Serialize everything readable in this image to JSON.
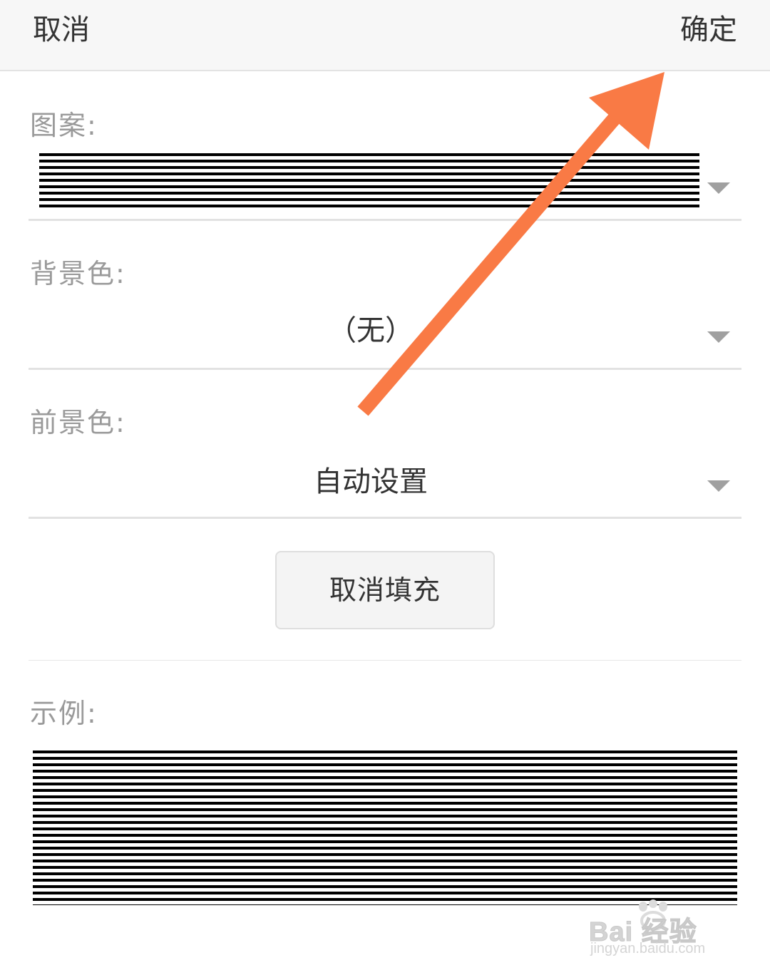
{
  "header": {
    "cancel_label": "取消",
    "confirm_label": "确定"
  },
  "pattern": {
    "label": "图案:"
  },
  "background_color": {
    "label": "背景色:",
    "value": "（无）"
  },
  "foreground_color": {
    "label": "前景色:",
    "value": "自动设置"
  },
  "no_fill_button": {
    "label": "取消填充"
  },
  "preview": {
    "label": "示例:"
  },
  "annotation": {
    "arrow_color": "#f97a45"
  },
  "watermark": {
    "brand": "Bai 经验",
    "url": "jingyan.baidu.com"
  },
  "icons": {
    "dropdown": "chevron-down-icon",
    "annotation": "arrow-annotation-icon",
    "watermark": "baidu-paw-icon"
  }
}
